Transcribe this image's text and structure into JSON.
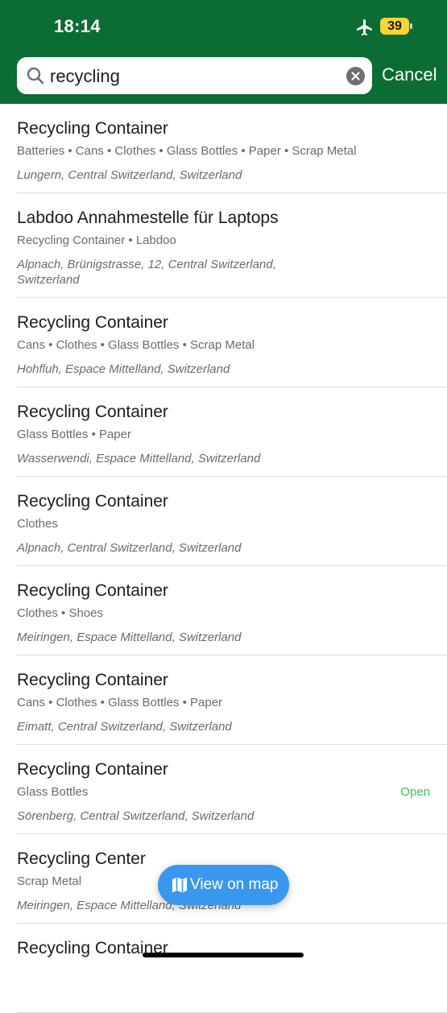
{
  "status_bar": {
    "time": "18:14",
    "battery": "39"
  },
  "search": {
    "query": "recycling",
    "cancel_label": "Cancel"
  },
  "results": [
    {
      "title": "Recycling Container",
      "subtitle": "Batteries • Cans • Clothes • Glass Bottles • Paper • Scrap Metal",
      "address": "Lungern, Central Switzerland, Switzerland",
      "status": ""
    },
    {
      "title": "Labdoo Annahmestelle für Laptops",
      "subtitle": "Recycling Container • Labdoo",
      "address": "Alpnach, Brünigstrasse, 12, Central Switzerland, Switzerland",
      "status": ""
    },
    {
      "title": "Recycling Container",
      "subtitle": "Cans • Clothes • Glass Bottles • Scrap Metal",
      "address": "Hohfluh, Espace Mittelland, Switzerland",
      "status": ""
    },
    {
      "title": "Recycling Container",
      "subtitle": "Glass Bottles • Paper",
      "address": "Wasserwendi, Espace Mittelland, Switzerland",
      "status": ""
    },
    {
      "title": "Recycling Container",
      "subtitle": "Clothes",
      "address": "Alpnach, Central Switzerland, Switzerland",
      "status": ""
    },
    {
      "title": "Recycling Container",
      "subtitle": "Clothes • Shoes",
      "address": "Meiringen, Espace Mittelland, Switzerland",
      "status": ""
    },
    {
      "title": "Recycling Container",
      "subtitle": "Cans • Clothes • Glass Bottles • Paper",
      "address": "Eimatt, Central Switzerland, Switzerland",
      "status": ""
    },
    {
      "title": "Recycling Container",
      "subtitle": "Glass Bottles",
      "address": "Sörenberg, Central Switzerland, Switzerland",
      "status": "Open"
    },
    {
      "title": "Recycling Center",
      "subtitle": "Scrap Metal",
      "address": "Meiringen, Espace Mittelland, Switzerland",
      "status": ""
    },
    {
      "title": "Recycling Container",
      "subtitle": "",
      "address": "",
      "status": ""
    }
  ],
  "map_button": {
    "label": "View on map",
    "icon": "map-icon"
  },
  "colors": {
    "header": "#0b6d34",
    "accent": "#3a97ee",
    "open": "#34c759",
    "battery": "#f9d535"
  }
}
